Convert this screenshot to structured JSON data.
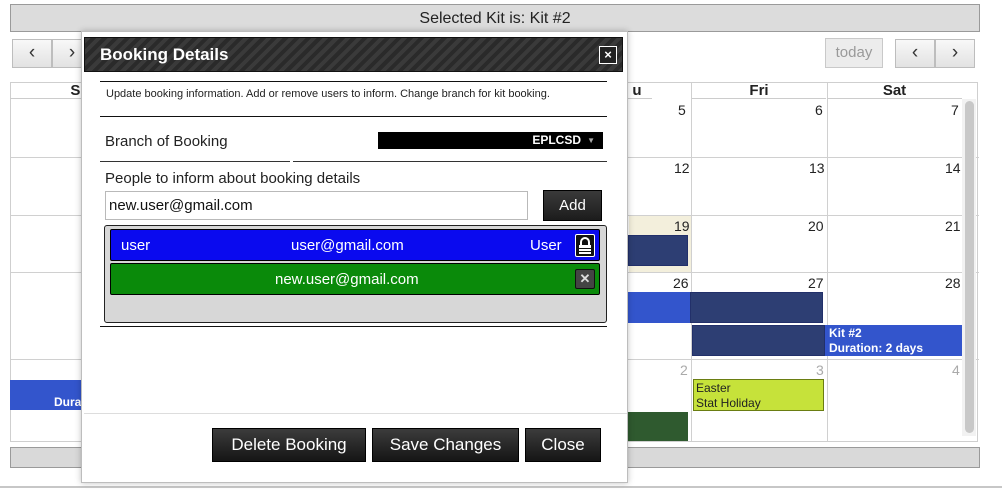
{
  "calendar": {
    "selected_kit_text": "Selected Kit is: Kit #2",
    "prev_label": "‹",
    "next_label": "›",
    "today_label": "today",
    "day_headers": [
      "Su",
      "u",
      "Fri",
      "Sat"
    ],
    "day_numbers": {
      "w1": [
        "5",
        "6",
        "7"
      ],
      "w2": [
        "12",
        "13",
        "14"
      ],
      "w3": [
        "19",
        "20",
        "21"
      ],
      "w4": [
        "26",
        "27",
        "28"
      ],
      "w5": [
        "2",
        "3",
        "4"
      ]
    },
    "events": {
      "kit_title": "Kit #2",
      "kit_duration": "Duration: 2 days",
      "left_duration": "Dura",
      "holiday_line1": "Easter",
      "holiday_line2": "Stat Holiday"
    }
  },
  "modal": {
    "title": "Booking Details",
    "close_icon": "×",
    "description": "Update booking information. Add or remove users to inform. Change branch for kit booking.",
    "branch_label": "Branch of Booking",
    "branch_value": "EPLCSD",
    "people_label": "People to inform about booking details",
    "email_input_value": "new.user@gmail.com",
    "add_label": "Add",
    "people": [
      {
        "name": "user",
        "email": "user@gmail.com",
        "role": "User",
        "icon": "lock-icon",
        "color": "#0a0aef"
      },
      {
        "email": "new.user@gmail.com",
        "icon": "remove-icon",
        "color": "#0a8a0a"
      }
    ],
    "buttons": {
      "delete": "Delete Booking",
      "save": "Save Changes",
      "close": "Close"
    }
  },
  "colors": {
    "user_row": "#0a0aef",
    "new_user_row": "#0a8a0a",
    "event_dark": "#2d3e73",
    "event_blue": "#3355cc",
    "holiday": "#c6e23a"
  }
}
